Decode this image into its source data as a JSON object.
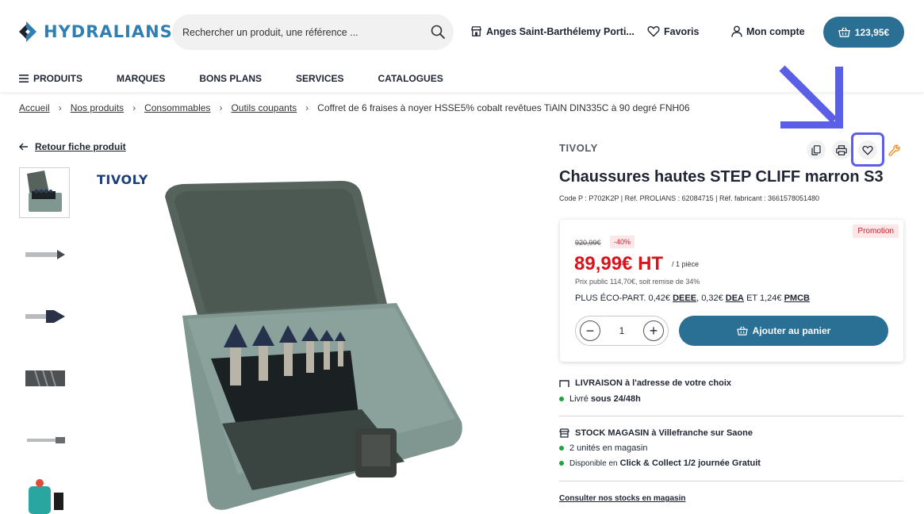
{
  "header": {
    "logo_text": "HYDRALIANS",
    "search_placeholder": "Rechercher un produit, une référence ...",
    "store_label": "Anges Saint-Barthélemy Porti...",
    "favorites_label": "Favoris",
    "account_label": "Mon compte",
    "cart_total": "123,95€"
  },
  "nav": {
    "items": [
      "PRODUITS",
      "MARQUES",
      "BONS PLANS",
      "SERVICES",
      "CATALOGUES"
    ]
  },
  "breadcrumb": {
    "items": [
      "Accueil",
      "Nos produits",
      "Consommables",
      "Outils coupants"
    ],
    "current": "Coffret de 6 fraises à noyer HSSE5% cobalt revêtues TiAlN DIN335C à 90 degré FNH06"
  },
  "gallery": {
    "back_label": "Retour fiche produit",
    "brand_logo": "TIVOLY"
  },
  "product": {
    "brand": "TIVOLY",
    "title": "Chaussures hautes STEP CLIFF marron S3",
    "refs": "Code P : P702K2P | Réf. PROLIANS : 62084715 | Réf. fabricant : 3661578051480"
  },
  "pricing": {
    "promo_badge": "Promotion",
    "old_price": "920,99€",
    "discount": "-40%",
    "price": "89,99€ HT",
    "unit": "/ 1 pièce",
    "public_price": "Prix public 114,70€, soit remise de 34%",
    "eco_prefix": "PLUS ÉCO-PART. 0,42€",
    "eco_deee": "DEEE",
    "eco_mid1": ", 0,32€",
    "eco_dea": "DEA",
    "eco_mid2": "ET 1,24€",
    "eco_pmcb": "PMCB",
    "quantity": "1",
    "add_to_cart": "Ajouter au panier"
  },
  "delivery": {
    "title_bold": "LIVRAISON",
    "title_rest": "à l'adresse de votre choix",
    "line_prefix": "Livré",
    "line_bold": "sous 24/48h"
  },
  "stock": {
    "title_bold": "STOCK MAGASIN",
    "title_rest": "à Villefranche sur Saone",
    "units": "2 unités en magasin",
    "cc_prefix": "Disponible en",
    "cc_bold": "Click & Collect 1/2 journée Gratuit",
    "link": "Consulter nos stocks en magasin"
  },
  "colors": {
    "brand_blue": "#2a6f94",
    "logo_blue": "#2f7fb4",
    "price_red": "#d9131b",
    "highlight": "#5b5fe6",
    "stock_green": "#23a33c",
    "tool_orange": "#f08a1c"
  },
  "icons": [
    "hydralians-logo-icon",
    "search-icon",
    "store-icon",
    "heart-icon",
    "user-icon",
    "basket-icon",
    "menu-icon",
    "arrow-left-icon",
    "copy-icon",
    "print-icon",
    "wrench-icon",
    "truck-icon",
    "shop-icon",
    "pointer-arrow-icon"
  ]
}
